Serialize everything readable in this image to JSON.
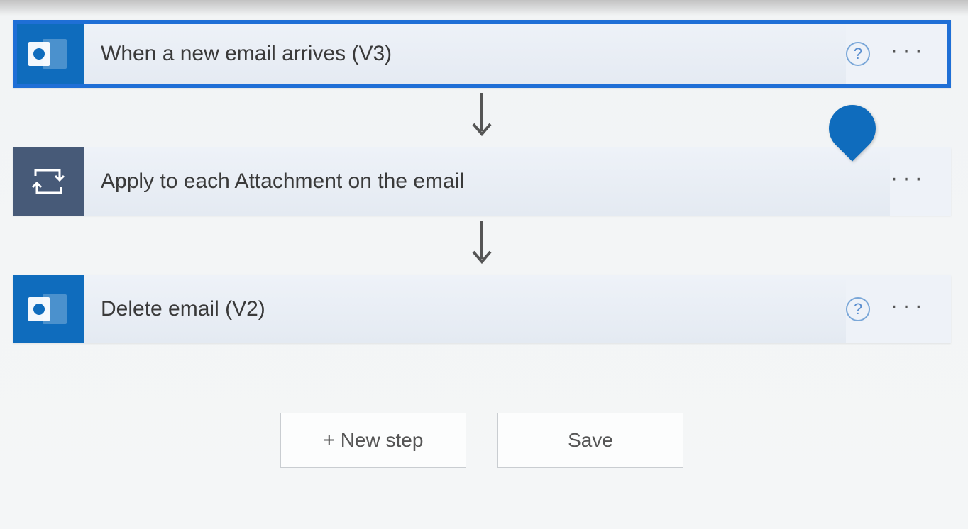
{
  "flow": {
    "steps": [
      {
        "title": "When a new email arrives (V3)",
        "iconType": "outlook",
        "showHelp": true,
        "selected": true
      },
      {
        "title": "Apply to each Attachment on the email",
        "iconType": "loop",
        "showHelp": false,
        "selected": false
      },
      {
        "title": "Delete email (V2)",
        "iconType": "outlook",
        "showHelp": true,
        "selected": false
      }
    ]
  },
  "buttons": {
    "newStep": "+ New step",
    "save": "Save"
  },
  "glyphs": {
    "help": "?",
    "more": "···"
  },
  "colors": {
    "accent": "#0f6cbd",
    "loopIconBg": "#475a78"
  }
}
